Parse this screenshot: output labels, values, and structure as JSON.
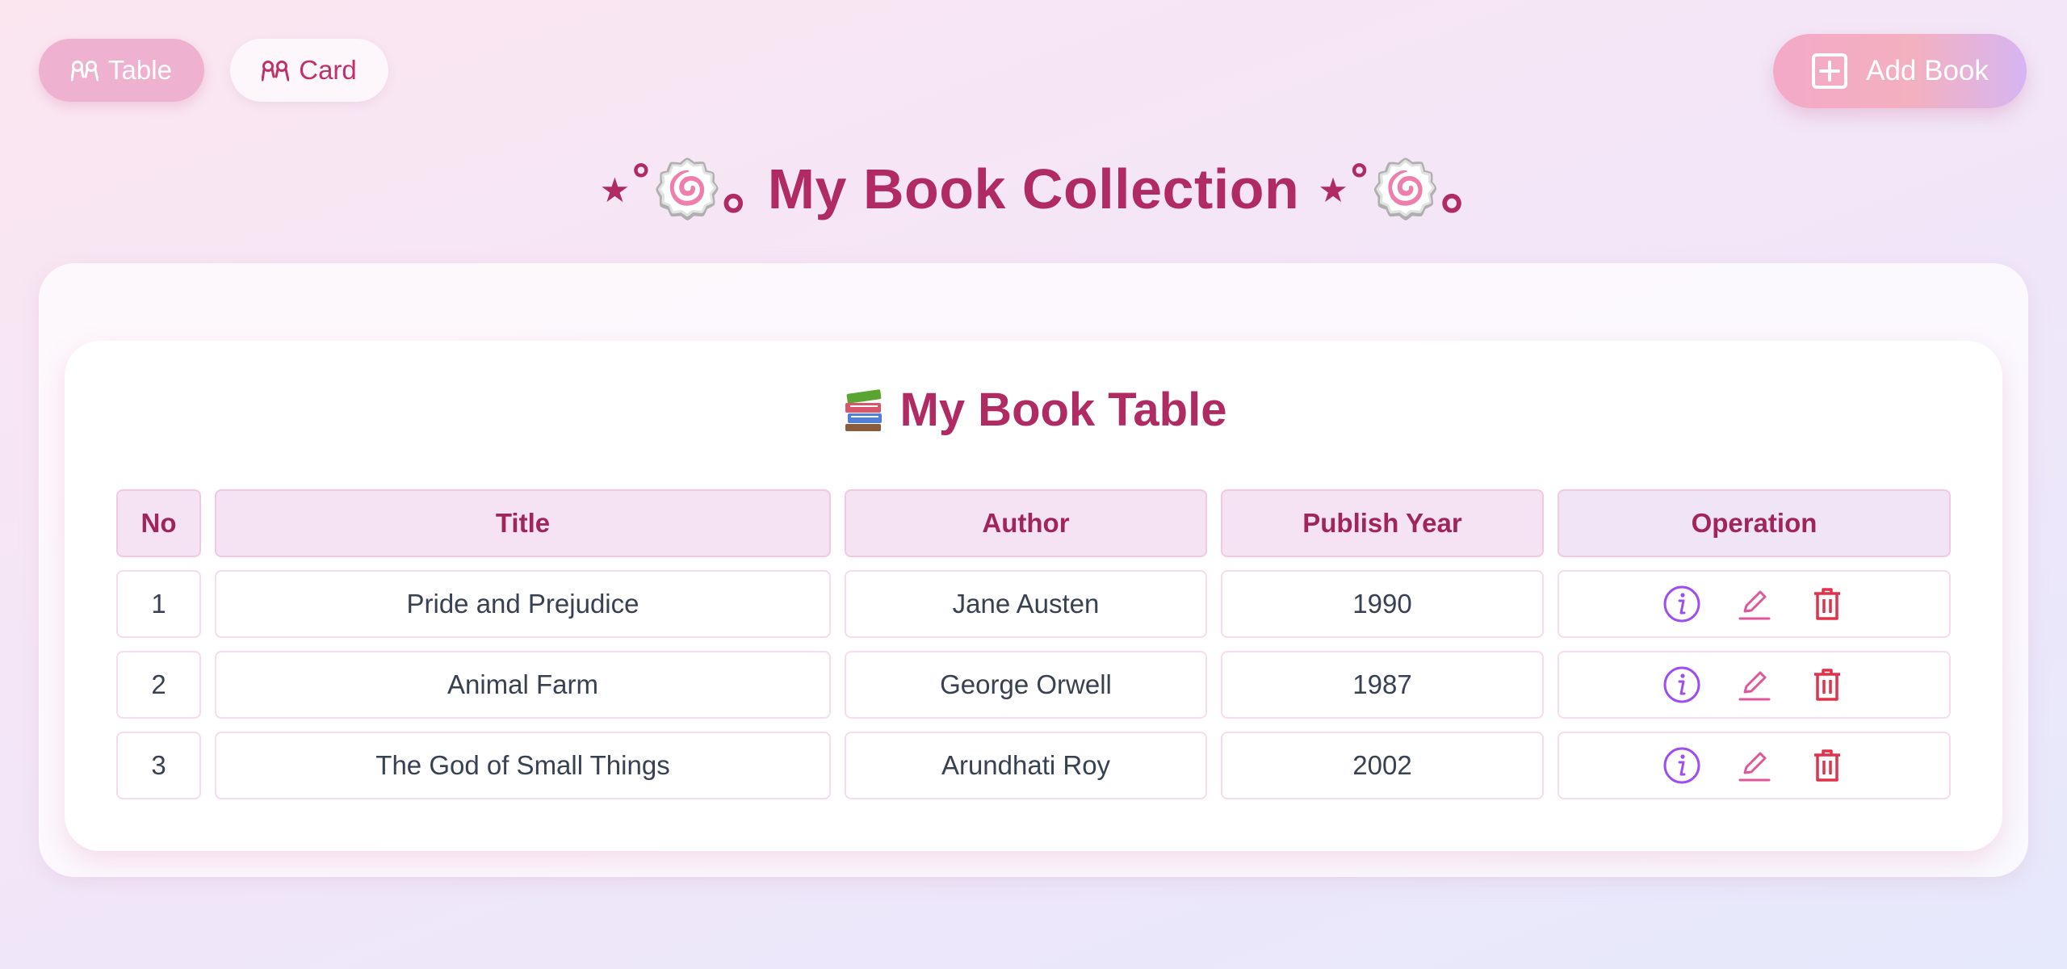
{
  "toolbar": {
    "table_label": "Table",
    "card_label": "Card",
    "add_label": "Add Book"
  },
  "page_title": "⋆˚🍥｡ My Book Collection ⋆˚🍥｡",
  "card": {
    "emoji": "books-icon",
    "title": "My Book Table"
  },
  "table": {
    "headers": [
      "No",
      "Title",
      "Author",
      "Publish Year",
      "Operation"
    ],
    "rows": [
      {
        "no": "1",
        "title": "Pride and Prejudice",
        "author": "Jane Austen",
        "year": "1990"
      },
      {
        "no": "2",
        "title": "Animal Farm",
        "author": "George Orwell",
        "year": "1987"
      },
      {
        "no": "3",
        "title": "The God of Small Things",
        "author": "Arundhati Roy",
        "year": "2002"
      }
    ]
  },
  "icons": {
    "view": "info-icon",
    "edit": "edit-icon",
    "delete": "trash-icon"
  },
  "colors": {
    "accent": "#b02a63",
    "info": "#9d4ef0",
    "edit": "#e0569a",
    "delete": "#e0324a"
  }
}
